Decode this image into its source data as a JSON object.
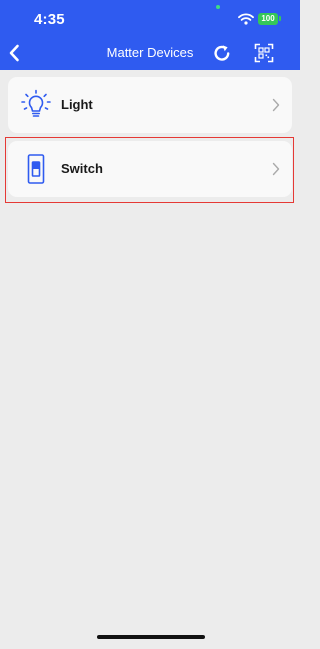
{
  "status_bar": {
    "time": "4:35",
    "battery": "100"
  },
  "nav": {
    "title": "Matter Devices",
    "back_icon": "chevron-left-icon",
    "refresh_icon": "refresh-icon",
    "scan_icon": "qr-scan-icon"
  },
  "devices": [
    {
      "label": "Light",
      "icon": "lightbulb-icon"
    },
    {
      "label": "Switch",
      "icon": "switch-icon"
    }
  ],
  "colors": {
    "header": "#2f5bf0",
    "accent_icon": "#2f5bf0",
    "background": "#ececec",
    "card": "#f9f9f9",
    "highlight": "#e53935",
    "battery": "#35c759"
  }
}
